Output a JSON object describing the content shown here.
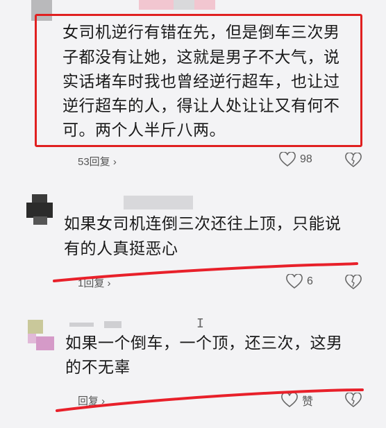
{
  "comments": [
    {
      "text_lines": [
        "女司机逆行有错在先，但是倒车三次男",
        "子都没有让她，这就是男子不大气，说",
        "实话堵车时我也曾经逆行超车，也让过",
        "逆行超车的人，得让人处让让又有何不",
        "可。两个人半斤八两。"
      ],
      "reply_label": "53回复 ›",
      "like_count": "98",
      "highlight_color": "#e02020"
    },
    {
      "text_lines": [
        "如果女司机连倒三次还往上顶，只能说",
        "有的人真挺恶心"
      ],
      "reply_label": "1回复 ›",
      "like_count": "6"
    },
    {
      "text_lines": [
        "如果一个倒车，一个顶，还三次，这男",
        "的不无辜"
      ],
      "reply_label": "回复 ›",
      "like_count": "赞"
    }
  ],
  "colors": {
    "underline": "#e8202a",
    "box": "#e02020",
    "background": "#f3f3f5"
  }
}
